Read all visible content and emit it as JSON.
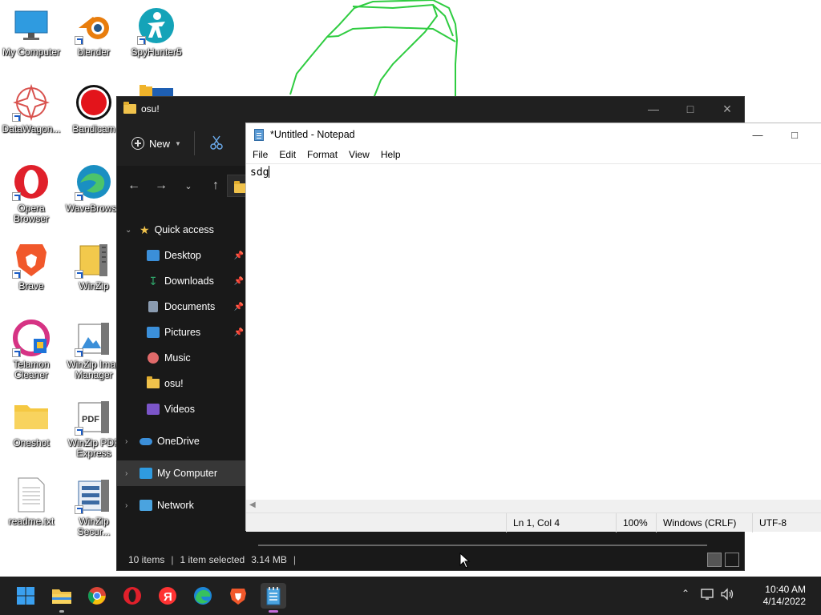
{
  "desktop": {
    "icons": [
      {
        "label": "My Computer",
        "icon": "monitor-icon"
      },
      {
        "label": "blender",
        "icon": "blender-icon"
      },
      {
        "label": "SpyHunter5",
        "icon": "spyhunter-icon"
      },
      {
        "label": "DataWagon...",
        "icon": "datawagon-icon"
      },
      {
        "label": "Bandicam",
        "icon": "bandicam-icon"
      },
      {
        "label": "Opera Browser",
        "icon": "opera-icon"
      },
      {
        "label": "WaveBrowse",
        "icon": "wavebrowser-icon"
      },
      {
        "label": "Brave",
        "icon": "brave-icon"
      },
      {
        "label": "WinZip",
        "icon": "winzip-icon"
      },
      {
        "label": "Telamon Cleaner",
        "icon": "telamon-icon"
      },
      {
        "label": "WinZip Imag Manager",
        "icon": "winzip-image-icon"
      },
      {
        "label": "Oneshot",
        "icon": "folder-icon"
      },
      {
        "label": "WinZip PDF Express",
        "icon": "winzip-pdf-icon"
      },
      {
        "label": "readme.txt",
        "icon": "text-file-icon"
      },
      {
        "label": "WinZip Secur...",
        "icon": "winzip-secure-icon"
      }
    ]
  },
  "explorer": {
    "title": "osu!",
    "toolbar": {
      "new_label": "New"
    },
    "sidebar": {
      "quick_access": "Quick access",
      "items": [
        {
          "label": "Desktop",
          "icon": "desktop-folder-icon",
          "color": "#3b8fd9",
          "pinned": true
        },
        {
          "label": "Downloads",
          "icon": "download-icon",
          "color": "#2fa66a",
          "pinned": true
        },
        {
          "label": "Documents",
          "icon": "documents-icon",
          "color": "#8a9bb0",
          "pinned": true
        },
        {
          "label": "Pictures",
          "icon": "pictures-icon",
          "color": "#3b8fd9",
          "pinned": true
        },
        {
          "label": "Music",
          "icon": "music-icon",
          "color": "#e06a6a",
          "pinned": false
        },
        {
          "label": "osu!",
          "icon": "folder-icon",
          "color": "#f0c24b",
          "pinned": false
        },
        {
          "label": "Videos",
          "icon": "videos-icon",
          "color": "#7b55c9",
          "pinned": false
        }
      ],
      "onedrive": "OneDrive",
      "my_computer": "My Computer",
      "network": "Network"
    },
    "status": {
      "items": "10 items",
      "selected": "1 item selected",
      "size": "3.14 MB"
    }
  },
  "notepad": {
    "title": "*Untitled - Notepad",
    "menu": [
      "File",
      "Edit",
      "Format",
      "View",
      "Help"
    ],
    "content": "sdg",
    "status": {
      "position": "Ln 1, Col 4",
      "zoom": "100%",
      "line_ending": "Windows (CRLF)",
      "encoding": "UTF-8"
    }
  },
  "taskbar": {
    "apps": [
      "start-icon",
      "file-explorer-icon",
      "chrome-icon",
      "opera-icon",
      "yandex-icon",
      "edge-icon",
      "brave-shield-icon",
      "notepad-icon"
    ],
    "yandex_glyph": "Я",
    "clock": {
      "time": "10:40 AM",
      "date": "4/14/2022"
    }
  },
  "colors": {
    "accent": "#c66ddb",
    "explorer_bg": "#191919",
    "taskbar_bg": "#1f1f1f"
  }
}
